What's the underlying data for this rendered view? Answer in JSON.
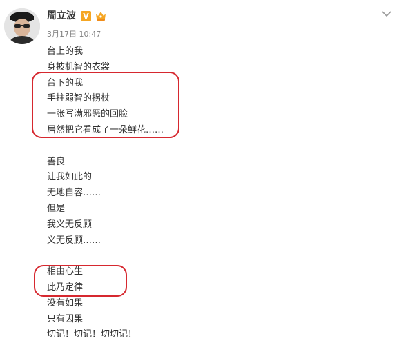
{
  "post": {
    "author": "周立波",
    "verified_mark": "V",
    "timestamp": "3月17日 10:47",
    "menu_icon": "chevron-down-icon",
    "avatar_icon": "avatar",
    "vip_icon": "crown-badge-icon",
    "lines": [
      "台上的我",
      "身披机智的衣裳",
      "台下的我",
      "手拄弱智的拐杖",
      "一张写满邪恶的回脸",
      "居然把它看成了一朵鲜花……",
      "",
      "善良",
      "让我如此的",
      "无地自容……",
      "但是",
      "我义无反顾",
      "义无反顾……",
      "",
      "相由心生",
      "此乃定律",
      "没有如果",
      "只有因果",
      "切记！切记！切切记！"
    ]
  },
  "colors": {
    "text": "#333333",
    "timestamp": "#808080",
    "annotation": "#d6282f",
    "verified": "#f5a623"
  }
}
